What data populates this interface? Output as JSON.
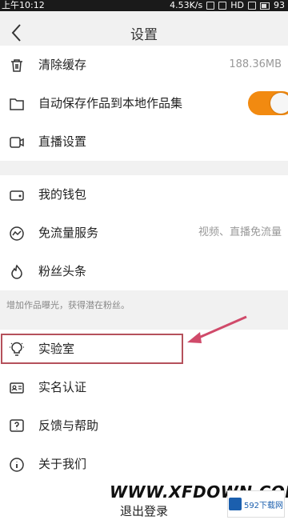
{
  "status_bar": {
    "time": "上午10:12",
    "speed": "4.53K/s",
    "network": "HD",
    "battery": "93"
  },
  "navbar": {
    "title": "设置"
  },
  "section1": [
    {
      "icon": "trash-icon",
      "label": "清除缓存",
      "value": "188.36MB"
    },
    {
      "icon": "folder-icon",
      "label": "自动保存作品到本地作品集",
      "toggle": true
    },
    {
      "icon": "video-camera-icon",
      "label": "直播设置"
    }
  ],
  "section2": [
    {
      "icon": "wallet-icon",
      "label": "我的钱包"
    },
    {
      "icon": "data-free-icon",
      "label": "免流量服务",
      "value": "视频、直播免流量"
    },
    {
      "icon": "flame-icon",
      "label": "粉丝头条"
    }
  ],
  "section2_hint": "增加作品曝光，获得潜在粉丝。",
  "section3": [
    {
      "icon": "lightbulb-icon",
      "label": "实验室"
    },
    {
      "icon": "id-card-icon",
      "label": "实名认证"
    },
    {
      "icon": "question-icon",
      "label": "反馈与帮助"
    },
    {
      "icon": "info-icon",
      "label": "关于我们"
    }
  ],
  "logout": {
    "label": "退出登录"
  },
  "watermark": {
    "text": "WWW.XFDOWN.COM",
    "logo_text": "592下载网"
  },
  "colors": {
    "toggle_on": "#f28a10",
    "highlight": "#b5515b",
    "arrow": "#d04a6a"
  }
}
